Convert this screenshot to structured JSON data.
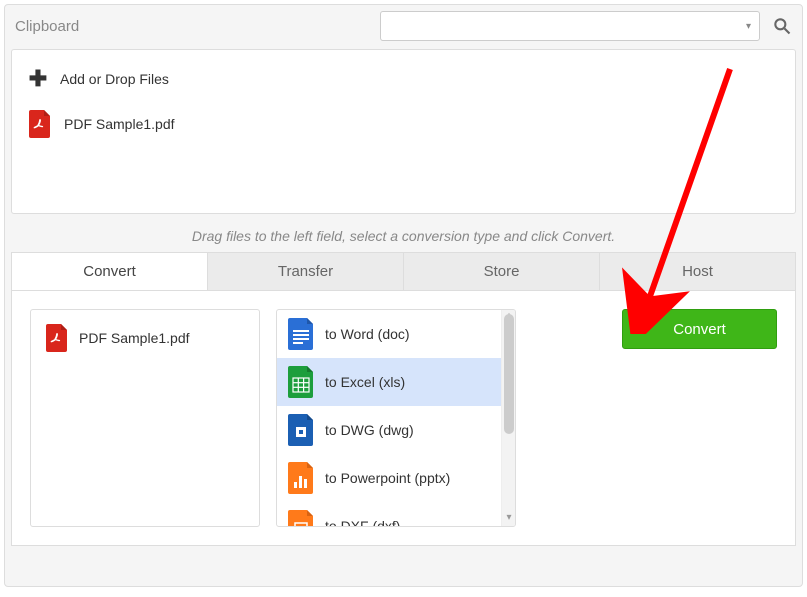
{
  "header": {
    "title": "Clipboard",
    "search_placeholder": ""
  },
  "dropzone": {
    "add_label": "Add or Drop Files",
    "file_name": "PDF Sample1.pdf"
  },
  "hint": "Drag files to the left field, select a conversion type and click Convert.",
  "tabs": {
    "convert": "Convert",
    "transfer": "Transfer",
    "store": "Store",
    "host": "Host"
  },
  "selected_file": "PDF Sample1.pdf",
  "formats": [
    {
      "label": "to Word (doc)"
    },
    {
      "label": "to Excel (xls)"
    },
    {
      "label": "to DWG (dwg)"
    },
    {
      "label": "to Powerpoint (pptx)"
    },
    {
      "label": "to DXF (dxf)"
    }
  ],
  "action": {
    "convert": "Convert"
  }
}
